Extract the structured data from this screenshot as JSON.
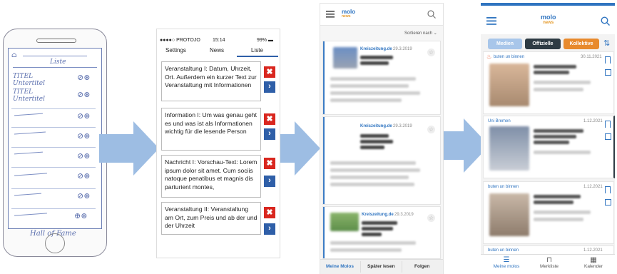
{
  "sketch": {
    "top_label": "Liste",
    "title1": "TITEL",
    "sub1": "Untertitel",
    "title2": "TITEL",
    "sub2": "Untertitel",
    "footer": "Hall of Fame"
  },
  "wireframe": {
    "carrier": "●●●●○ PROTOJO",
    "time": "15:14",
    "battery": "99% ▬",
    "tabs": [
      "Settings",
      "News",
      "Liste"
    ],
    "cards": [
      "Veranstaltung I: Datum, Uhrzeit, Ort. Außerdem ein kurzer Text zur Veranstaltung mit Informationen",
      "Information I: Um was genau geht es und was ist als Informationen wichtig für die lesende Person",
      "Nachricht I: Vorschau-Text: Lorem ipsum dolor sit amet. Cum sociis natoque penatibus et magnis dis parturient montes,",
      "Veranstaltung II: Veranstaltung am Ort, zum Preis und ab der und der Uhrzeit"
    ],
    "delete_glyph": "✖",
    "open_glyph": "›"
  },
  "app_v1": {
    "logo_top": "molo",
    "logo_bottom": "news",
    "sort": "Sortieren nach",
    "items": [
      {
        "source": "Kreiszeitung.de",
        "date": "29.3.2019"
      },
      {
        "source": "Kreiszeitung.de",
        "date": "29.3.2019"
      },
      {
        "source": "Kreiszeitung.de",
        "date": "29.3.2019"
      }
    ],
    "tabs": [
      "Meine Molos",
      "Später lesen",
      "Folgen"
    ]
  },
  "app_v2": {
    "logo_top": "molo",
    "logo_bottom": "news",
    "filters": [
      "Medien",
      "Offizielle",
      "Kollektive"
    ],
    "items": [
      {
        "source": "buten un binnen",
        "date": "30.11.2021"
      },
      {
        "source": "Uni Bremen",
        "date": "1.12.2021"
      },
      {
        "source": "buten un binnen",
        "date": "1.12.2021"
      },
      {
        "source": "buten un binnen",
        "date": "1.12.2021"
      }
    ],
    "nav": [
      "Meine molos",
      "Merkliste",
      "Kalender"
    ]
  },
  "colors": {
    "arrow": "#9dbde3",
    "accent_blue": "#2f74c0",
    "delete_red": "#d9271f",
    "filter_medien": "#a8c6ea",
    "filter_offizielle": "#2e3b44",
    "filter_kollektive": "#e88a2d"
  }
}
